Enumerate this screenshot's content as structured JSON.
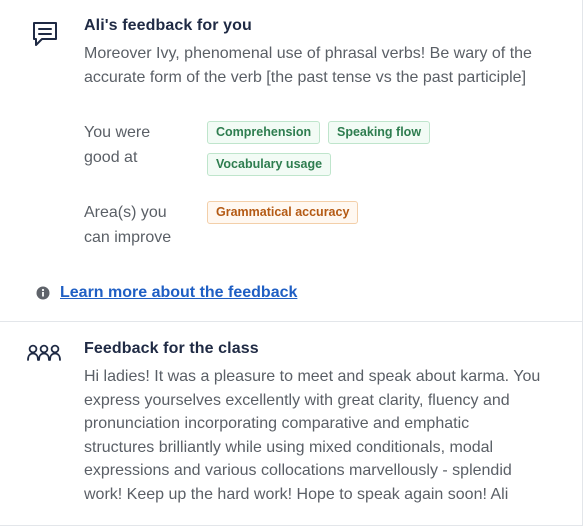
{
  "personal_feedback": {
    "icon": "chat-message-icon",
    "title": "Ali's feedback for you",
    "message_lines": [
      "Moreover Ivy, phenomenal use of phrasal verbs! Be wary of the",
      "accurate form of the verb [the past tense vs the past participle]"
    ],
    "good_label_lines": [
      "You were",
      "good at"
    ],
    "good_tags": [
      "Comprehension",
      "Speaking flow",
      "Vocabulary usage"
    ],
    "improve_label_lines": [
      "Area(s) you",
      "can improve"
    ],
    "improve_tags": [
      "Grammatical accuracy"
    ],
    "learn_more_link": "Learn more about the feedback",
    "info_icon": "info-icon"
  },
  "class_feedback": {
    "icon": "group-icon",
    "title": "Feedback for the class",
    "message_lines": [
      "Hi ladies! It was a pleasure to meet and speak about karma. You",
      "express yourselves excellently with great clarity, fluency and",
      "pronunciation incorporating comparative and emphatic",
      "structures brilliantly while using mixed conditionals, modal",
      "expressions and various collocations marvellously - splendid",
      "work! Keep up the hard work! Hope to speak again soon! Ali"
    ]
  },
  "colors": {
    "heading": "#1f2a44",
    "body": "#5a5f66",
    "good_tag_text": "#2e7d4f",
    "improve_tag_text": "#b45a14",
    "link": "#1f5fc4"
  }
}
